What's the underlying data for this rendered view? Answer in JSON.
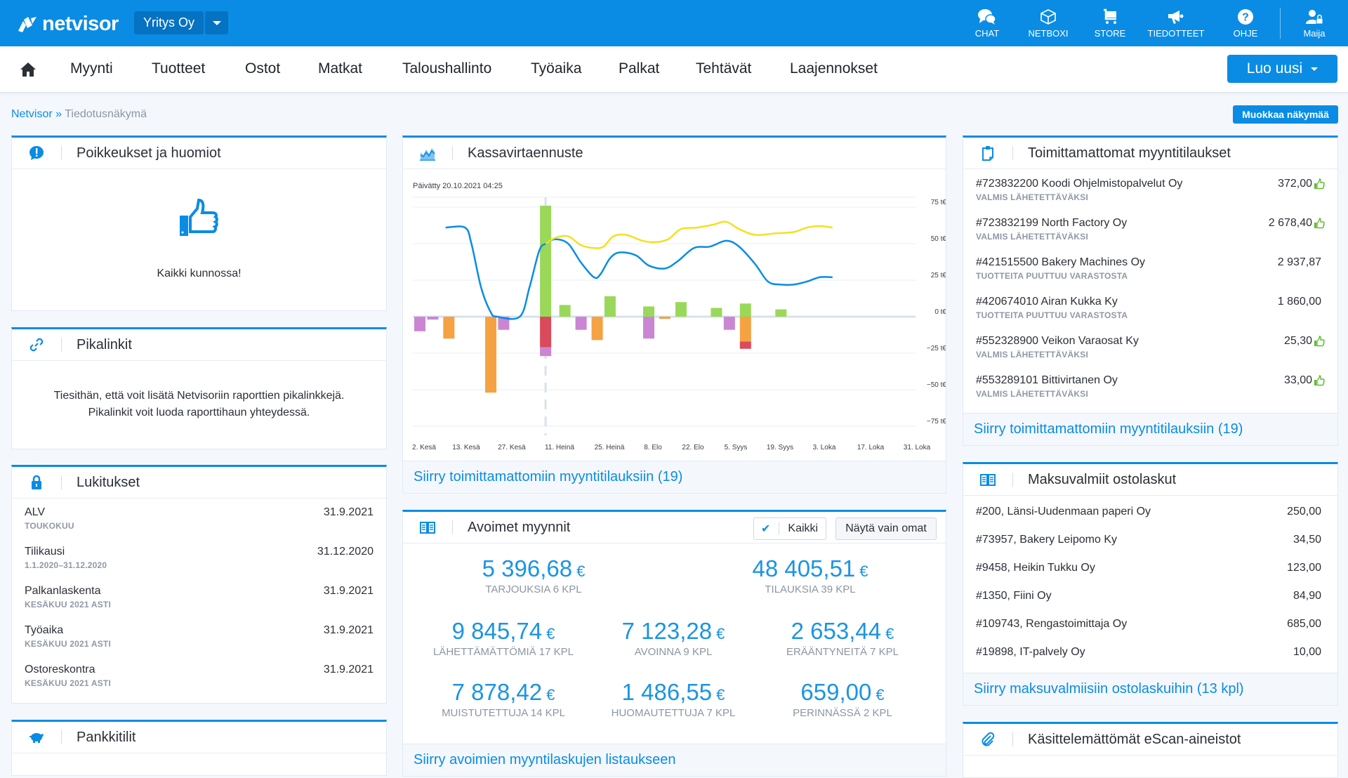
{
  "topbar": {
    "logo_text": "netvisor",
    "company": "Yritys Oy",
    "icons": [
      {
        "name": "chat-icon",
        "label": "CHAT"
      },
      {
        "name": "box-icon",
        "label": "NETBOXI"
      },
      {
        "name": "cart-icon",
        "label": "STORE"
      },
      {
        "name": "megaphone-icon",
        "label": "TIEDOTTEET"
      },
      {
        "name": "help-icon",
        "label": "OHJE"
      }
    ],
    "user": {
      "name": "Maija"
    },
    "brand_color": "#0a8ce4"
  },
  "nav": {
    "items": [
      "Myynti",
      "Tuotteet",
      "Ostot",
      "Matkat",
      "Taloushallinto",
      "Työaika",
      "Palkat",
      "Tehtävät",
      "Laajennokset"
    ],
    "create_button": "Luo uusi"
  },
  "breadcrumb": {
    "root": "Netvisor",
    "separator": "»",
    "current": "Tiedotusnäkymä"
  },
  "edit_view_button": "Muokkaa näkymää",
  "panels": {
    "exceptions": {
      "title": "Poikkeukset ja huomiot",
      "message": "Kaikki kunnossa!"
    },
    "quicklinks": {
      "title": "Pikalinkit",
      "line1": "Tiesithän, että voit lisätä Netvisoriin raporttien pikalinkkejä.",
      "line2": "Pikalinkit voit luoda raporttihaun yhteydessä."
    },
    "locks": {
      "title": "Lukitukset",
      "rows": [
        {
          "title": "ALV",
          "sub": "TOUKOKUU",
          "date": "31.9.2021"
        },
        {
          "title": "Tilikausi",
          "sub": "1.1.2020–31.12.2020",
          "date": "31.12.2020"
        },
        {
          "title": "Palkanlaskenta",
          "sub": "KESÄKUU 2021 ASTI",
          "date": "31.9.2021"
        },
        {
          "title": "Työaika",
          "sub": "KESÄKUU 2021 ASTI",
          "date": "31.9.2021"
        },
        {
          "title": "Ostoreskontra",
          "sub": "KESÄKUU 2021 ASTI",
          "date": "31.9.2021"
        }
      ]
    },
    "bank": {
      "title": "Pankkitilit"
    },
    "cashflow": {
      "title": "Kassavirtaennuste",
      "updated": "Päivätty 20.10.2021 04:25",
      "link": "Siirry toimittamattomiin myyntitilauksiin (19)"
    },
    "open_sales": {
      "title": "Avoimet myynnit",
      "toggle_all": "Kaikki",
      "toggle_all_checked": true,
      "toggle_own": "Näytä vain omat",
      "kpis": [
        {
          "value": "5 396,68",
          "currency": "€",
          "label": "TARJOUKSIA 6 KPL"
        },
        {
          "value": "48 405,51",
          "currency": "€",
          "label": "TILAUKSIA 39 KPL"
        },
        {
          "value": "9 845,74",
          "currency": "€",
          "label": "LÄHETTÄMÄTTÖMIÄ 17 KPL"
        },
        {
          "value": "7 123,28",
          "currency": "€",
          "label": "AVOINNA 9 KPL"
        },
        {
          "value": "2 653,44",
          "currency": "€",
          "label": "ERÄÄNTYNEITÄ 7 KPL"
        },
        {
          "value": "7 878,42",
          "currency": "€",
          "label": "MUISTUTETTUJA 14 KPL"
        },
        {
          "value": "1 486,55",
          "currency": "€",
          "label": "HUOMAUTETTUJA 7 KPL"
        },
        {
          "value": "659,00",
          "currency": "€",
          "label": "PERINNÄSSÄ 2 KPL"
        }
      ],
      "link": "Siirry avoimien myyntilaskujen listaukseen"
    },
    "undelivered": {
      "title": "Toimittamattomat myyntitilaukset",
      "rows": [
        {
          "title": "#723832200 Koodi Ohjelmistopalvelut Oy",
          "sub": "VALMIS LÄHETETTÄVÄKSI",
          "amount": "372,00",
          "ok": true
        },
        {
          "title": "#723832199 North Factory Oy",
          "sub": "VALMIS LÄHETETTÄVÄKSI",
          "amount": "2 678,40",
          "ok": true
        },
        {
          "title": "#421515500 Bakery Machines Oy",
          "sub": "TUOTTEITA PUUTTUU VARASTOSTA",
          "amount": "2 937,87",
          "ok": false
        },
        {
          "title": "#420674010 Airan Kukka Ky",
          "sub": "TUOTTEITA PUUTTUU VARASTOSTA",
          "amount": "1 860,00",
          "ok": false
        },
        {
          "title": "#552328900 Veikon Varaosat Ky",
          "sub": "VALMIS LÄHETETTÄVÄKSI",
          "amount": "25,30",
          "ok": true
        },
        {
          "title": "#553289101 Bittivirtanen Oy",
          "sub": "VALMIS LÄHETETTÄVÄKSI",
          "amount": "33,00",
          "ok": true
        }
      ],
      "link": "Siirry toimittamattomiin myyntitilauksiin (19)"
    },
    "payables": {
      "title": "Maksuvalmiit ostolaskut",
      "rows": [
        {
          "title": "#200, Länsi-Uudenmaan paperi Oy",
          "amount": "250,00"
        },
        {
          "title": "#73957, Bakery Leipomo Ky",
          "amount": "34,50"
        },
        {
          "title": "#9458, Heikin Tukku Oy",
          "amount": "123,00"
        },
        {
          "title": "#1350, Fiini Oy",
          "amount": "84,90"
        },
        {
          "title": "#109743, Rengastoimittaja Oy",
          "amount": "685,00"
        },
        {
          "title": "#19898, IT-palvely Oy",
          "amount": "10,00"
        }
      ],
      "link": "Siirry maksuvalmiisiin ostolaskuihin (13 kpl)"
    },
    "escan": {
      "title": "Käsittelemättömät eScan-aineistot"
    }
  },
  "chart_data": {
    "type": "bar",
    "title": "Kassavirtaennuste",
    "subtitle": "Päivätty 20.10.2021 04:25",
    "x_tick_labels": [
      "2. Kesä",
      "13. Kesä",
      "27. Kesä",
      "11. Heinä",
      "25. Heinä",
      "8. Elo",
      "22. Elo",
      "5. Syys",
      "19. Syys",
      "3. Loka",
      "17. Loka",
      "31. Loka"
    ],
    "y_tick_labels": [
      "75 t€",
      "50 t€",
      "25 t€",
      "0 t€",
      "−25 t€",
      "−50 t€",
      "−75 t€"
    ],
    "y_ticks": [
      75,
      50,
      25,
      0,
      -25,
      -50,
      -75
    ],
    "ylim": [
      -75,
      80
    ],
    "xlim": [
      0,
      152
    ],
    "y_unit": "t€",
    "grid": true,
    "today_marker_day": 39,
    "colors": {
      "green": "#9ad85a",
      "orange": "#f5a243",
      "purple": "#cb86d3",
      "red": "#db4a5a",
      "blue_line": "#0a8ce4",
      "yellow_line": "#f5e020"
    },
    "bars": [
      {
        "day": 0,
        "segments": [
          {
            "color": "purple",
            "from": 0,
            "to": -10
          }
        ]
      },
      {
        "day": 4,
        "segments": [
          {
            "color": "purple",
            "from": 0,
            "to": -2
          }
        ]
      },
      {
        "day": 9,
        "segments": [
          {
            "color": "orange",
            "from": 0,
            "to": -15
          }
        ]
      },
      {
        "day": 22,
        "segments": [
          {
            "color": "orange",
            "from": 0,
            "to": -52
          }
        ]
      },
      {
        "day": 26,
        "segments": [
          {
            "color": "purple",
            "from": 0,
            "to": -9
          }
        ]
      },
      {
        "day": 39,
        "segments": [
          {
            "color": "green",
            "from": 0,
            "to": 76
          },
          {
            "color": "red",
            "from": 0,
            "to": -21
          },
          {
            "color": "purple",
            "from": -21,
            "to": -27
          }
        ]
      },
      {
        "day": 45,
        "segments": [
          {
            "color": "green",
            "from": 0,
            "to": 8
          }
        ]
      },
      {
        "day": 50,
        "segments": [
          {
            "color": "purple",
            "from": 0,
            "to": -9
          }
        ]
      },
      {
        "day": 55,
        "segments": [
          {
            "color": "orange",
            "from": 0,
            "to": -16
          }
        ]
      },
      {
        "day": 59,
        "segments": [
          {
            "color": "green",
            "from": 0,
            "to": 14
          }
        ]
      },
      {
        "day": 71,
        "segments": [
          {
            "color": "green",
            "from": 0,
            "to": 7
          },
          {
            "color": "purple",
            "from": 0,
            "to": -15
          }
        ]
      },
      {
        "day": 76,
        "segments": [
          {
            "color": "orange",
            "from": 0,
            "to": -1.5
          }
        ]
      },
      {
        "day": 81,
        "segments": [
          {
            "color": "green",
            "from": 0,
            "to": 10
          }
        ]
      },
      {
        "day": 92,
        "segments": [
          {
            "color": "green",
            "from": 0,
            "to": 6
          }
        ]
      },
      {
        "day": 96,
        "segments": [
          {
            "color": "purple",
            "from": 0,
            "to": -9
          }
        ]
      },
      {
        "day": 101,
        "segments": [
          {
            "color": "green",
            "from": 0,
            "to": 9
          },
          {
            "color": "orange",
            "from": 0,
            "to": -17
          },
          {
            "color": "red",
            "from": -17,
            "to": -22
          }
        ]
      },
      {
        "day": 112,
        "segments": [
          {
            "color": "green",
            "from": 0,
            "to": 5
          }
        ]
      }
    ],
    "series": [
      {
        "name": "balance",
        "color": "blue_line",
        "points": [
          [
            8,
            61
          ],
          [
            14,
            61
          ],
          [
            16,
            50
          ],
          [
            19,
            20
          ],
          [
            22,
            3
          ],
          [
            24,
            0
          ],
          [
            31,
            0
          ],
          [
            34,
            20
          ],
          [
            37,
            45
          ],
          [
            39,
            50
          ],
          [
            42,
            53
          ],
          [
            46,
            50
          ],
          [
            50,
            37
          ],
          [
            54,
            27
          ],
          [
            56,
            29
          ],
          [
            59,
            40
          ],
          [
            62,
            44
          ],
          [
            67,
            42
          ],
          [
            71,
            35
          ],
          [
            76,
            33
          ],
          [
            80,
            38
          ],
          [
            85,
            47
          ],
          [
            90,
            48
          ],
          [
            95,
            52
          ],
          [
            99,
            48
          ],
          [
            104,
            36
          ],
          [
            108,
            24
          ],
          [
            112,
            22
          ],
          [
            116,
            22
          ],
          [
            120,
            24
          ],
          [
            124,
            27
          ],
          [
            128,
            27
          ]
        ]
      },
      {
        "name": "forecast",
        "color": "yellow_line",
        "points": [
          [
            39,
            50
          ],
          [
            42,
            54
          ],
          [
            46,
            55
          ],
          [
            50,
            49
          ],
          [
            54,
            47
          ],
          [
            57,
            48
          ],
          [
            60,
            55
          ],
          [
            64,
            56
          ],
          [
            69,
            52
          ],
          [
            73,
            51
          ],
          [
            77,
            53
          ],
          [
            81,
            60
          ],
          [
            86,
            61
          ],
          [
            91,
            63
          ],
          [
            95,
            65
          ],
          [
            99,
            60
          ],
          [
            104,
            56
          ],
          [
            110,
            57
          ],
          [
            116,
            58
          ],
          [
            120,
            61
          ],
          [
            124,
            62
          ],
          [
            128,
            61
          ]
        ]
      }
    ]
  }
}
